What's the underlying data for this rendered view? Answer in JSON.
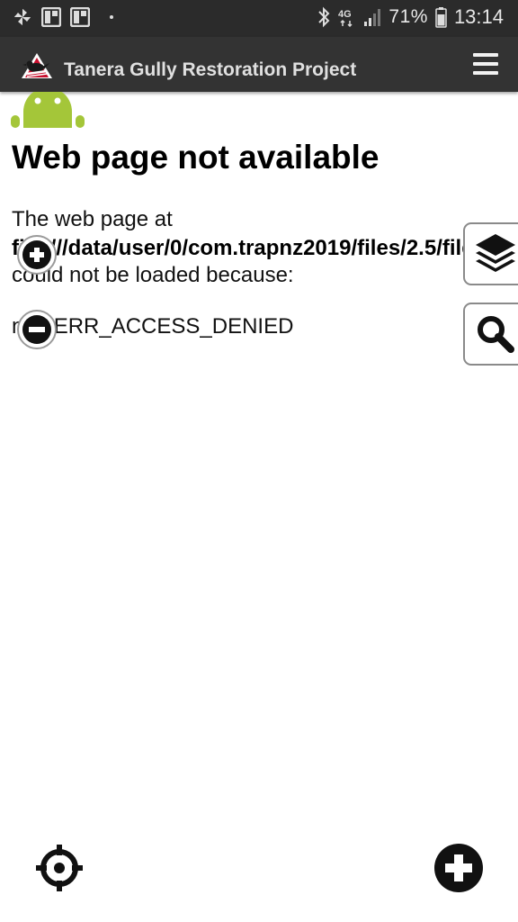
{
  "status_bar": {
    "battery_percent": "71%",
    "network": "4G",
    "time": "13:14",
    "icons": [
      "pinwheel-icon",
      "gallery-icon",
      "gallery-icon",
      "notification-dot-icon",
      "bluetooth-icon",
      "network-4g-icon",
      "signal-icon",
      "battery-icon"
    ]
  },
  "app_bar": {
    "title": "Tanera Gully Restoration Project",
    "logo_icon": "bird-logo-icon",
    "menu_icon": "hamburger-menu-icon",
    "color": "#333333"
  },
  "error_page": {
    "title": "Web page not available",
    "line1": "The web page at",
    "line2": "file:///data/user/0/com.trapnz2019/files/2.5/file",
    "line3": "could not be loaded because:",
    "line4": "net::ERR_ACCESS_DENIED"
  },
  "map_controls": {
    "zoom_in_icon": "plus-icon",
    "zoom_out_icon": "minus-icon",
    "layers_icon": "layers-icon",
    "search_icon": "search-icon",
    "locate_icon": "crosshair-icon",
    "add_icon": "plus-circle-icon"
  }
}
